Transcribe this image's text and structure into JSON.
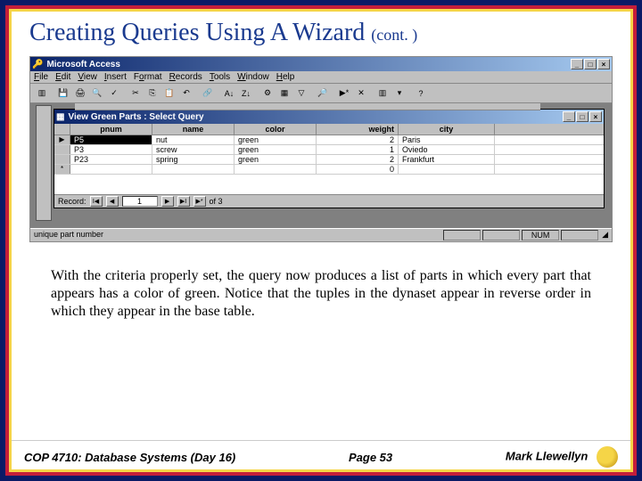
{
  "slide": {
    "title_main": "Creating Queries Using A Wizard ",
    "title_cont": "(cont. )"
  },
  "access": {
    "app_title": "Microsoft Access",
    "menus": [
      "File",
      "Edit",
      "View",
      "Insert",
      "Format",
      "Records",
      "Tools",
      "Window",
      "Help"
    ],
    "inner_title": "View Green Parts : Select Query",
    "columns": [
      "pnum",
      "name",
      "color",
      "weight",
      "city"
    ],
    "rows": [
      {
        "marker": "▶",
        "pnum": "P5",
        "name": "nut",
        "color": "green",
        "weight": "2",
        "city": "Paris"
      },
      {
        "marker": "",
        "pnum": "P3",
        "name": "screw",
        "color": "green",
        "weight": "1",
        "city": "Oviedo"
      },
      {
        "marker": "",
        "pnum": "P23",
        "name": "spring",
        "color": "green",
        "weight": "2",
        "city": "Frankfurt"
      },
      {
        "marker": "*",
        "pnum": "",
        "name": "",
        "color": "",
        "weight": "0",
        "city": ""
      }
    ],
    "record_label": "Record:",
    "record_current": "1",
    "record_total": "of  3",
    "status_left": "unique part number",
    "status_num": "NUM"
  },
  "paragraph": "With the criteria properly set, the query now produces a list of parts in which every part that appears has a color of green.  Notice that the tuples in the dynaset appear in reverse order in which they appear in the base table.",
  "footer": {
    "left": "COP 4710: Database Systems  (Day 16)",
    "center": "Page 53",
    "right": "Mark Llewellyn"
  }
}
